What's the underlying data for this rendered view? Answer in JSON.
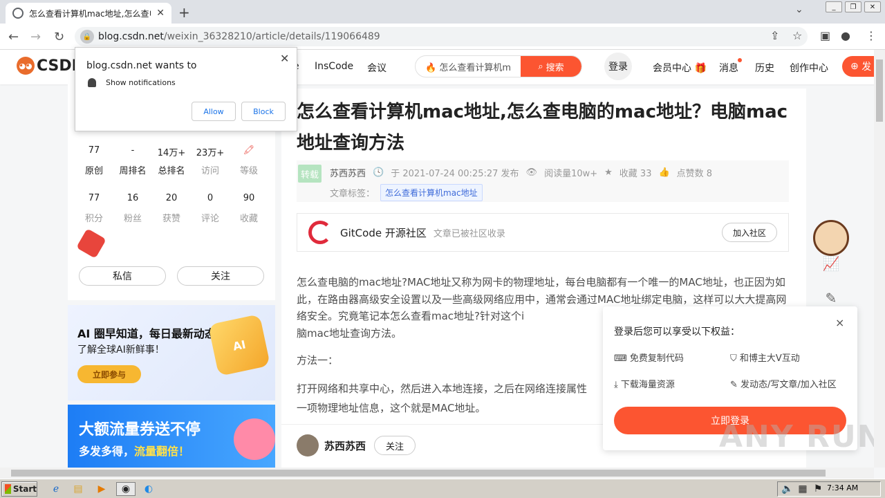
{
  "browser": {
    "tab_title": "怎么查看计算机mac地址,怎么查电脑",
    "tab_close": "✕",
    "new_tab": "+",
    "url_host": "blog.csdn.net",
    "url_path": "/weixin_36328210/article/details/119066489"
  },
  "csdn_header": {
    "logo_text": "CSDN",
    "nav_partial": "e",
    "nav_items": [
      "InsCode",
      "会议"
    ],
    "search_query": "怎么查看计算机m",
    "search_button": "搜索",
    "login": "登录",
    "right_nav": [
      "会员中心",
      "消息",
      "历史",
      "创作中心"
    ],
    "publish": "发"
  },
  "sidebar": {
    "stats_row1": [
      {
        "n": "77",
        "l": "原创"
      },
      {
        "n": "-",
        "l": "周排名"
      },
      {
        "n": "14万+",
        "l": "总排名"
      },
      {
        "n": "23万+",
        "l": "访问"
      },
      {
        "n": "",
        "l": "等级"
      }
    ],
    "stats_row2": [
      {
        "n": "77",
        "l": "积分"
      },
      {
        "n": "16",
        "l": "粉丝"
      },
      {
        "n": "20",
        "l": "获赞"
      },
      {
        "n": "0",
        "l": "评论"
      },
      {
        "n": "90",
        "l": "收藏"
      }
    ],
    "private_msg": "私信",
    "follow": "关注"
  },
  "ads": {
    "ad1_title": "AI 圈早知道，每日最新动态",
    "ad1_sub": "了解全球AI新鲜事！",
    "ad1_button": "立即参与",
    "ad1_cube": "AI",
    "ad2_title": "大额流量券送不停",
    "ad2_sub_a": "多发多得，",
    "ad2_sub_b": "流量翻倍！"
  },
  "article": {
    "title": "怎么查看计算机mac地址,怎么查电脑的mac地址？电脑mac地址查询方法",
    "repost_tag": "转载",
    "author": "苏西苏西",
    "date": "于 2021-07-24 00:25:27 发布",
    "reads": "阅读量10w+",
    "favorites": "收藏 33",
    "likes": "点赞数 8",
    "tags_label": "文章标签：",
    "tag": "怎么查看计算机mac地址",
    "gitcode_name": "GitCode 开源社区",
    "gitcode_sub": "文章已被社区收录",
    "gitcode_join": "加入社区",
    "para1": "怎么查电脑的mac地址?MAC地址又称为网卡的物理地址，每台电脑都有一个唯一的MAC地址，也正因为如此，在路由器高级安全设置以及一些高级网络应用中，通常会通过MAC地址绑定电脑，这样可以大大提高网络安全。究竟笔记本怎么查看mac地址?针对这个i",
    "para1_end": "脑mac地址查询方法。",
    "method1": "方法一：",
    "para2": "打开网络和共享中心，然后进入本地连接，之后在网络连接属性",
    "para2_end": "一项物理地址信息，这个就是MAC地址。",
    "author_bar_name": "苏西苏西",
    "author_bar_follow": "关注"
  },
  "login_popup": {
    "heading": "登录后您可以享受以下权益：",
    "close": "×",
    "benefits": [
      "免费复制代码",
      "和博主大V互动",
      "下载海量资源",
      "发动态/写文章/加入社区"
    ],
    "cta": "立即登录"
  },
  "permission_popup": {
    "site": "blog.csdn.net wants to",
    "item": "Show notifications",
    "allow": "Allow",
    "block": "Block",
    "close": "✕"
  },
  "watermark": "ANY RUN",
  "taskbar": {
    "start": "Start",
    "clock": "7:34 AM"
  },
  "colors": {
    "accent": "#fc5531",
    "link": "#1a73e8"
  }
}
